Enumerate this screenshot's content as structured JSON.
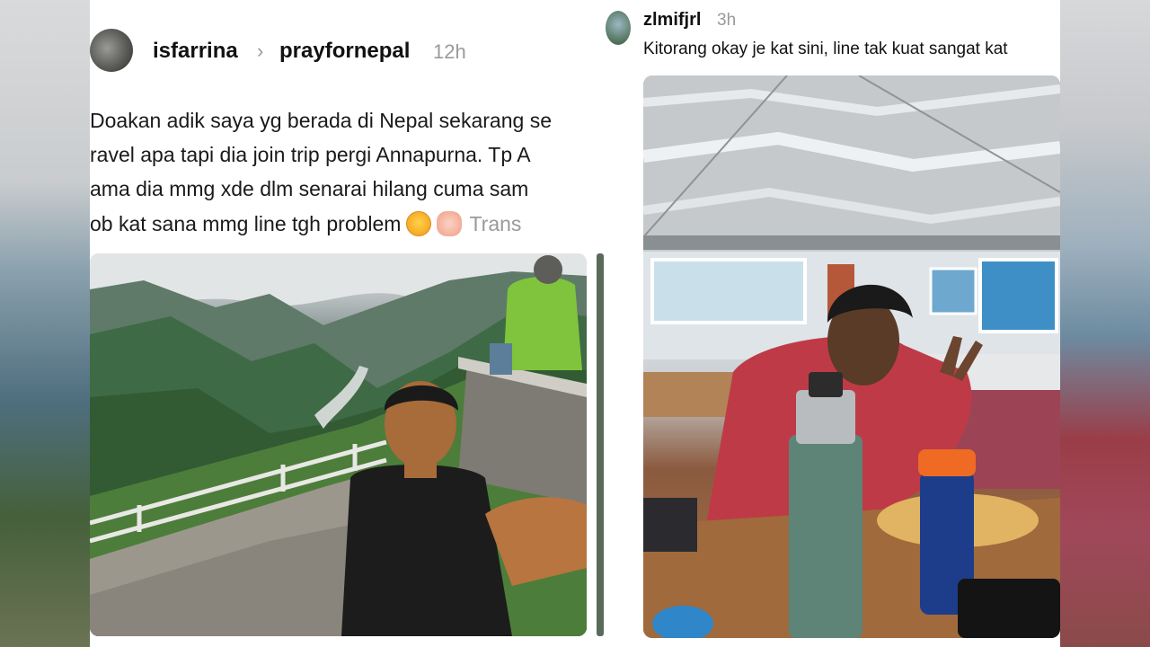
{
  "left_post": {
    "username": "isfarrina",
    "chevron": "›",
    "community": "prayfornepal",
    "time": "12h",
    "caption_lines": [
      "Doakan adik saya yg berada di Nepal sekarang se",
      "ravel apa tapi dia join trip pergi Annapurna. Tp A",
      "ama dia mmg xde dlm senarai hilang cuma sam",
      "ob kat sana mmg line tgh problem"
    ],
    "translate_label": "Trans",
    "emojis": [
      "pleading-face-icon",
      "praying-hands-icon"
    ]
  },
  "right_post": {
    "username": "zlmifjrl",
    "time": "3h",
    "caption": "Kitorang okay je kat sini, line tak kuat sangat kat"
  },
  "colors": {
    "username": "#111111",
    "timestamp": "#9a9a9a",
    "background": "#ffffff"
  }
}
